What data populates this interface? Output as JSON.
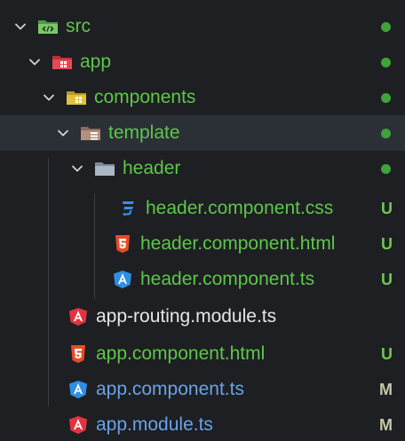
{
  "tree": {
    "src": {
      "label": "src",
      "icon": "folder-src-icon"
    },
    "app": {
      "label": "app",
      "icon": "folder-app-icon"
    },
    "components": {
      "label": "components",
      "icon": "folder-components-icon"
    },
    "template": {
      "label": "template",
      "icon": "folder-template-icon"
    },
    "header": {
      "label": "header",
      "icon": "folder-icon"
    },
    "files": [
      {
        "label": "header.component.css",
        "icon": "css-icon",
        "badge": "U"
      },
      {
        "label": "header.component.html",
        "icon": "html-icon",
        "badge": "U"
      },
      {
        "label": "header.component.ts",
        "icon": "angular-component-icon",
        "badge": "U"
      },
      {
        "label": "app-routing.module.ts",
        "icon": "angular-module-icon",
        "badge": ""
      },
      {
        "label": "app.component.html",
        "icon": "html-icon",
        "badge": "U"
      },
      {
        "label": "app.component.ts",
        "icon": "angular-component-icon",
        "badge": "M"
      },
      {
        "label": "app.module.ts",
        "icon": "angular-module-icon",
        "badge": "M"
      }
    ]
  },
  "colors": {
    "background": "#1e1f22",
    "selected_row": "#2b2f36",
    "untracked_green": "#5cc74a",
    "modified": "#c5c7aa",
    "dot": "#3fa33a"
  }
}
